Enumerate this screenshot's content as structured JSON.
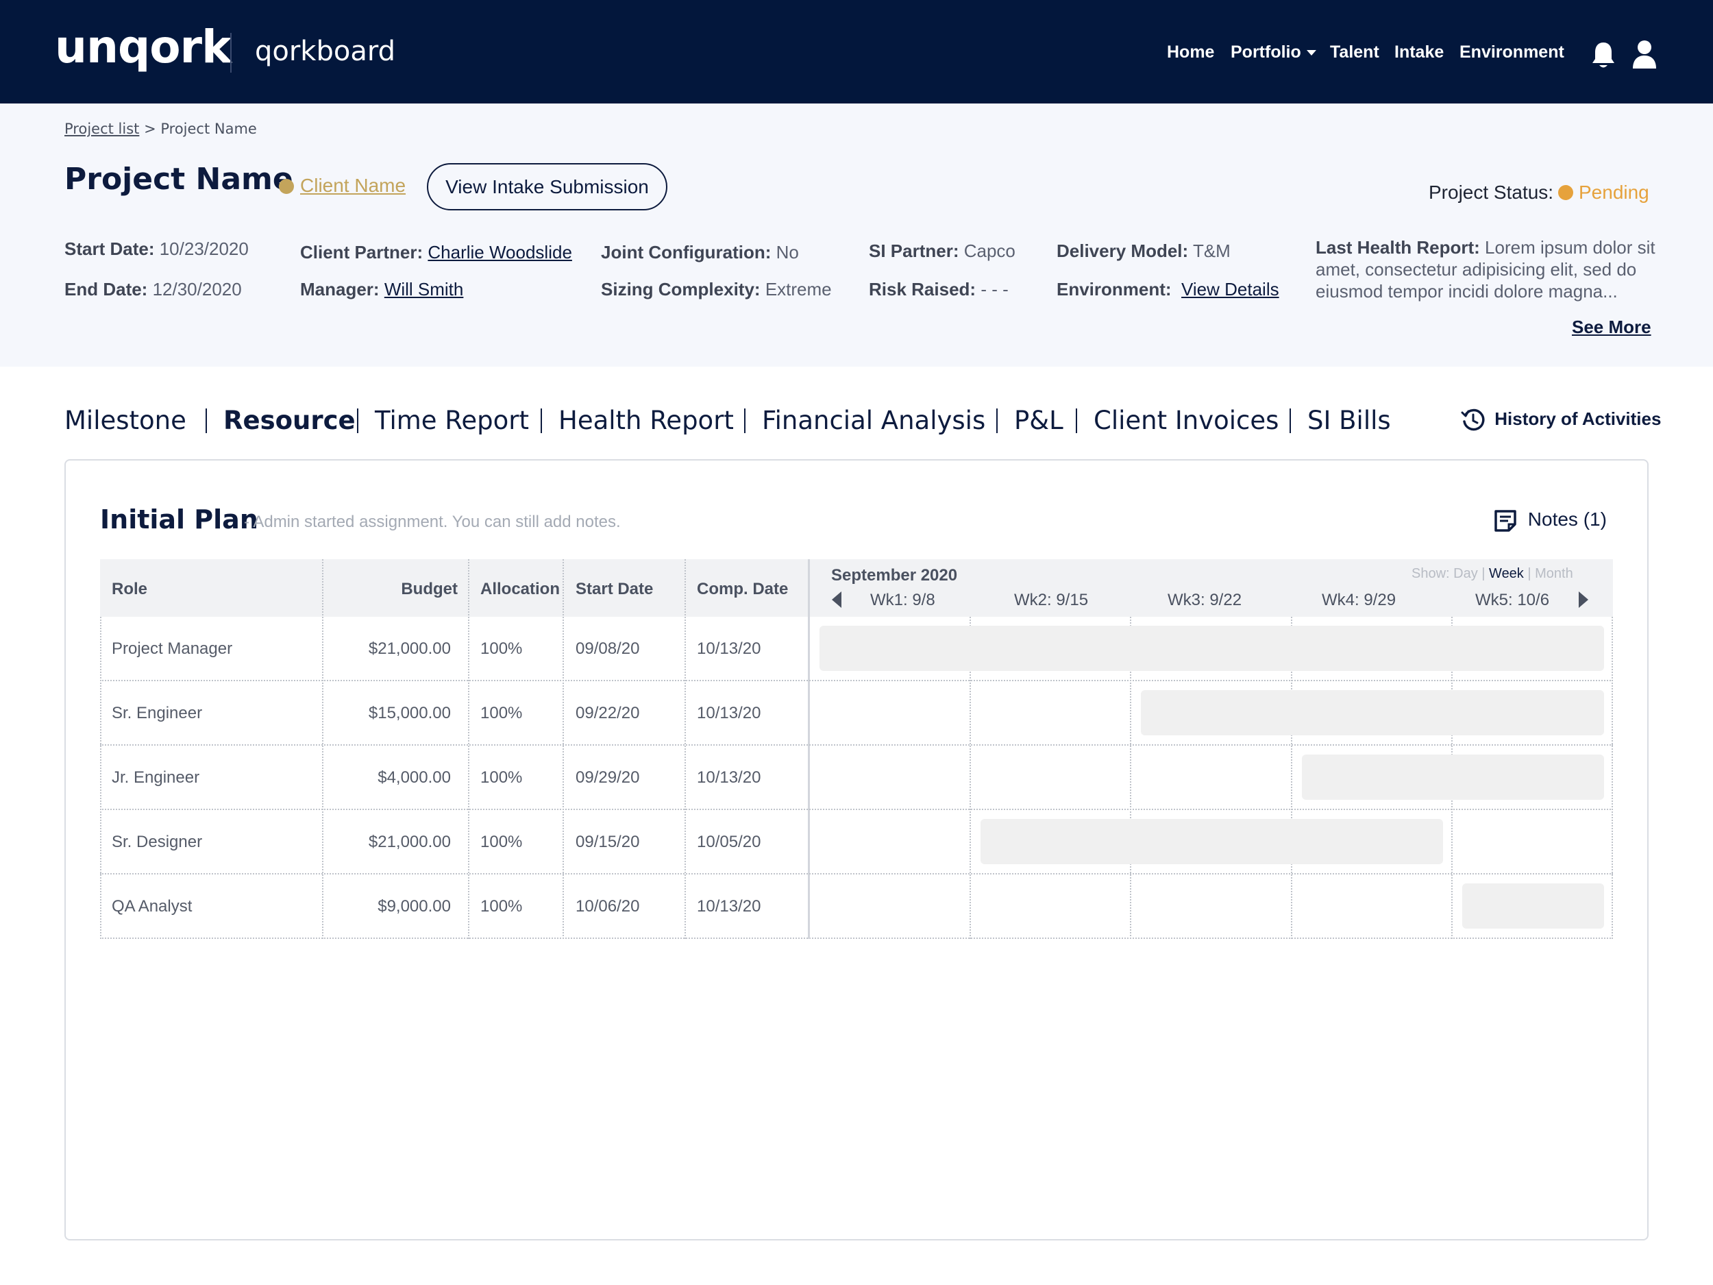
{
  "app": {
    "logo": "unqork",
    "product": "qorkboard"
  },
  "nav": {
    "home": "Home",
    "portfolio": "Portfolio",
    "talent": "Talent",
    "intake": "Intake",
    "environment": "Environment"
  },
  "breadcrumb": {
    "root": "Project list",
    "separator": ">",
    "current": "Project Name"
  },
  "project": {
    "title": "Project Name",
    "client": "Client Name",
    "intake_button": "View Intake Submission",
    "status_label": "Project Status:",
    "status": "Pending"
  },
  "meta": {
    "start_label": "Start Date:",
    "start": "10/23/2020",
    "end_label": "End Date:",
    "end": "12/30/2020",
    "partner_label": "Client Partner:",
    "partner": "Charlie Woodslide",
    "manager_label": "Manager:",
    "manager": "Will Smith",
    "joint_label": "Joint Configuration:",
    "joint": "No",
    "sizing_label": "Sizing Complexity:",
    "sizing": "Extreme",
    "si_label": "SI Partner:",
    "si": "Capco",
    "risk_label": "Risk Raised:",
    "risk": "- - -",
    "delivery_label": "Delivery Model:",
    "delivery": "T&M",
    "env_label": "Environment:",
    "env": "View Details",
    "health_label": "Last Health Report:",
    "health": "Lorem ipsum dolor sit amet, consectetur adipisicing elit, sed do eiusmod tempor incidi dolore magna...",
    "see_more": "See More"
  },
  "tabs": [
    "Milestone",
    "Resource",
    "Time Report",
    "Health Report",
    "Financial Analysis",
    "P&L",
    "Client Invoices",
    "SI Bills"
  ],
  "active_tab": "Resource",
  "history": "History of Activities",
  "plan": {
    "title": "Initial Plan",
    "subtitle": "- Admin started assignment. You can still add notes.",
    "notes": "Notes (1)"
  },
  "table": {
    "headers": [
      "Role",
      "Budget",
      "Allocation",
      "Start Date",
      "Comp. Date"
    ],
    "rows": [
      [
        "Project Manager",
        "$21,000.00",
        "100%",
        "09/08/20",
        "10/13/20"
      ],
      [
        "Sr. Engineer",
        "$15,000.00",
        "100%",
        "09/22/20",
        "10/13/20"
      ],
      [
        "Jr. Engineer",
        "$4,000.00",
        "100%",
        "09/29/20",
        "10/13/20"
      ],
      [
        "Sr. Designer",
        "$21,000.00",
        "100%",
        "09/15/20",
        "10/05/20"
      ],
      [
        "QA Analyst",
        "$9,000.00",
        "100%",
        "10/06/20",
        "10/13/20"
      ]
    ]
  },
  "timeline": {
    "month": "September 2020",
    "show_label": "Show:",
    "show_options": [
      "Day",
      "Week",
      "Month"
    ],
    "show_selected": "Week",
    "weeks": [
      "Wk1: 9/8",
      "Wk2: 9/15",
      "Wk3: 9/22",
      "Wk4: 9/29",
      "Wk5: 10/6"
    ]
  },
  "colors": {
    "nav_bg": "#03173C",
    "header_bg": "#F5F7FC",
    "navy": "#0D1B3E",
    "client_gold": "#C3A45B",
    "status_orange": "#E6A23C",
    "bar_fill": "#F0F0F0"
  }
}
